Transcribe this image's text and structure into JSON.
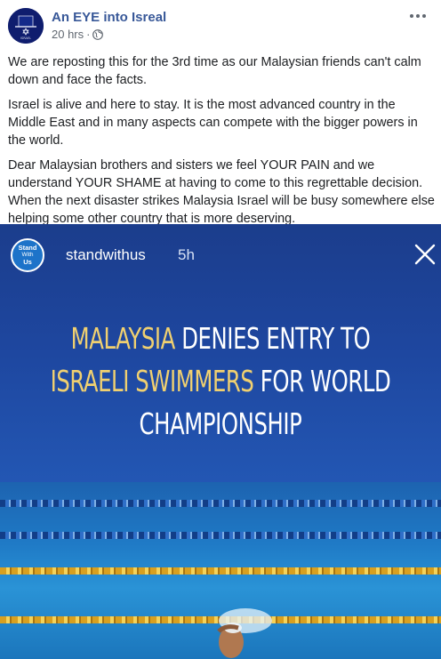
{
  "post": {
    "page_name": "An EYE into Isreal",
    "time": "20 hrs",
    "separator": "·",
    "paragraphs": [
      "We are reposting this for the 3rd time as our Malaysian friends can't calm down and face the facts.",
      "Israel is alive and here to stay. It is the most advanced country in the Middle East and in many aspects can compete with the bigger powers in the world.",
      "Dear Malaysian brothers and sisters we feel YOUR PAIN and we understand YOUR SHAME at having to come to this regrettable decision. When the next disaster strikes Malaysia Israel will be busy somewhere else helping some other country that is more deserving."
    ],
    "more_icon": "more-horizontal-icon",
    "privacy_icon": "globe-icon"
  },
  "shared_image": {
    "logo_text": [
      "Stand",
      "With",
      "Us"
    ],
    "account": "standwithus",
    "time": "5h",
    "close_icon": "close-icon",
    "headline": {
      "line1_hl": "MALAYSIA",
      "line1_rest": " DENIES ENTRY TO",
      "line2_hl": "ISRAELI SWIMMERS",
      "line2_rest": " FOR WORLD",
      "line3": "CHAMPIONSHIP"
    },
    "colors": {
      "highlight": "#f0d070",
      "background": "#1e47a0"
    }
  },
  "colors": {
    "link": "#385898",
    "meta": "#606770",
    "text": "#1c1e21"
  }
}
